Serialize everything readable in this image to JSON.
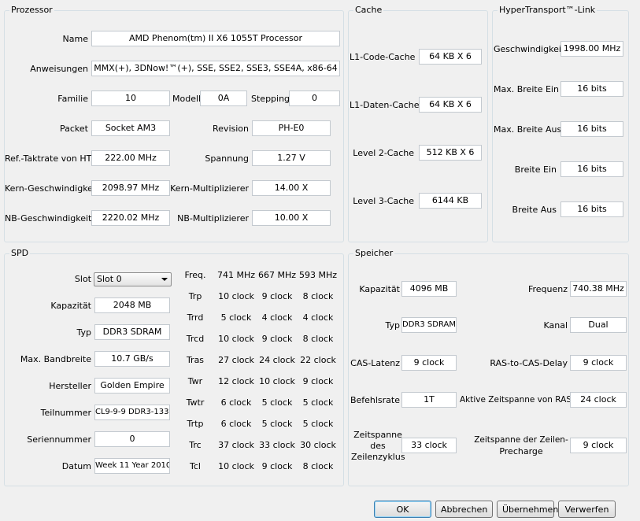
{
  "processor": {
    "legend": "Prozessor",
    "name_label": "Name",
    "name_value": "AMD Phenom(tm) II X6 1055T Processor",
    "instructions_label": "Anweisungen",
    "instructions_value": "MMX(+), 3DNow!™(+), SSE, SSE2, SSE3, SSE4A, x86-64",
    "family_label": "Familie",
    "family_value": "10",
    "model_label": "Modell",
    "model_value": "0A",
    "stepping_label": "Stepping",
    "stepping_value": "0",
    "package_label": "Packet",
    "package_value": "Socket AM3",
    "revision_label": "Revision",
    "revision_value": "PH-E0",
    "ht_ref_label": "Ref.-Taktrate von HT",
    "ht_ref_value": "222.00 MHz",
    "voltage_label": "Spannung",
    "voltage_value": "1.27 V",
    "core_speed_label": "Kern-Geschwindigkeit",
    "core_speed_value": "2098.97 MHz",
    "core_mult_label": "Kern-Multiplizierer",
    "core_mult_value": "14.00 X",
    "nb_speed_label": "NB-Geschwindigkeit",
    "nb_speed_value": "2220.02 MHz",
    "nb_mult_label": "NB-Multiplizierer",
    "nb_mult_value": "10.00 X"
  },
  "cache": {
    "legend": "Cache",
    "l1_code_label": "L1-Code-Cache",
    "l1_code_value": "64 KB X 6",
    "l1_data_label": "L1-Daten-Cache",
    "l1_data_value": "64 KB X 6",
    "l2_label": "Level 2-Cache",
    "l2_value": "512 KB X 6",
    "l3_label": "Level 3-Cache",
    "l3_value": "6144 KB"
  },
  "ht": {
    "legend": "HyperTransport™-Link",
    "speed_label": "Geschwindigkeit",
    "speed_value": "1998.00 MHz",
    "max_in_label": "Max. Breite Ein",
    "max_in_value": "16 bits",
    "max_out_label": "Max. Breite Aus",
    "max_out_value": "16 bits",
    "in_label": "Breite Ein",
    "in_value": "16 bits",
    "out_label": "Breite Aus",
    "out_value": "16 bits"
  },
  "spd": {
    "legend": "SPD",
    "slot_label": "Slot",
    "slot_value": "Slot 0",
    "capacity_label": "Kapazität",
    "capacity_value": "2048 MB",
    "type_label": "Typ",
    "type_value": "DDR3 SDRAM",
    "bandwidth_label": "Max. Bandbreite",
    "bandwidth_value": "10.7 GB/s",
    "vendor_label": "Hersteller",
    "vendor_value": "Golden Empire",
    "part_label": "Teilnummer",
    "part_value": "CL9-9-9 DDR3-1333",
    "serial_label": "Seriennummer",
    "serial_value": "0",
    "date_label": "Datum",
    "date_value": "Week 11 Year 2010",
    "timing_header": "Freq.",
    "freqs": [
      "741 MHz",
      "667 MHz",
      "593 MHz"
    ],
    "timings": [
      {
        "name": "Trp",
        "values": [
          "10 clock",
          "9 clock",
          "8 clock"
        ]
      },
      {
        "name": "Trrd",
        "values": [
          "5 clock",
          "4 clock",
          "4 clock"
        ]
      },
      {
        "name": "Trcd",
        "values": [
          "10 clock",
          "9 clock",
          "8 clock"
        ]
      },
      {
        "name": "Tras",
        "values": [
          "27 clock",
          "24 clock",
          "22 clock"
        ]
      },
      {
        "name": "Twr",
        "values": [
          "12 clock",
          "10 clock",
          "9 clock"
        ]
      },
      {
        "name": "Twtr",
        "values": [
          "6 clock",
          "5 clock",
          "5 clock"
        ]
      },
      {
        "name": "Trtp",
        "values": [
          "6 clock",
          "5 clock",
          "5 clock"
        ]
      },
      {
        "name": "Trc",
        "values": [
          "37 clock",
          "33 clock",
          "30 clock"
        ]
      },
      {
        "name": "Tcl",
        "values": [
          "10 clock",
          "9 clock",
          "8 clock"
        ]
      }
    ]
  },
  "memory": {
    "legend": "Speicher",
    "capacity_label": "Kapazität",
    "capacity_value": "4096 MB",
    "freq_label": "Frequenz",
    "freq_value": "740.38 MHz",
    "type_label": "Typ",
    "type_value": "DDR3 SDRAM",
    "channel_label": "Kanal",
    "channel_value": "Dual",
    "cas_label": "CAS-Latenz",
    "cas_value": "9 clock",
    "ras_cas_label": "RAS-to-CAS-Delay",
    "ras_cas_value": "9 clock",
    "cmd_rate_label": "Befehlsrate",
    "cmd_rate_value": "1T",
    "active_ras_label": "Aktive Zeitspanne von RAS",
    "active_ras_value": "24 clock",
    "row_cycle_label_1": "Zeitspanne",
    "row_cycle_label_2": "des",
    "row_cycle_label_3": "Zeilenzyklus",
    "row_cycle_value": "33 clock",
    "row_precharge_label_1": "Zeitspanne der Zeilen-",
    "row_precharge_label_2": "Precharge",
    "row_precharge_value": "9 clock"
  },
  "buttons": {
    "ok": "OK",
    "cancel": "Abbrechen",
    "apply": "Übernehmen",
    "discard": "Verwerfen"
  }
}
